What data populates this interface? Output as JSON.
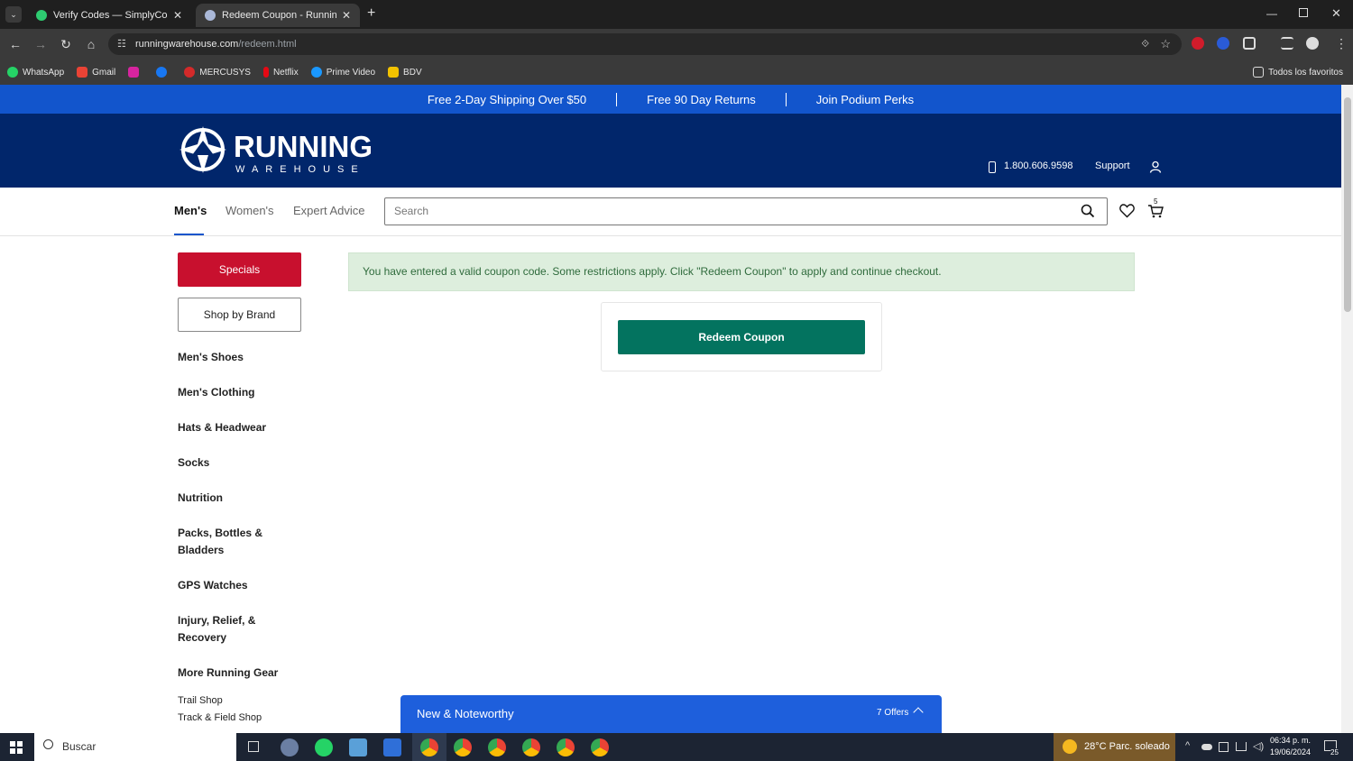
{
  "browser": {
    "tabs": [
      {
        "title": "Verify Codes — SimplyCodes",
        "active": false
      },
      {
        "title": "Redeem Coupon - Running Wa",
        "active": true
      }
    ],
    "new_tab": "+",
    "url_host": "runningwarehouse.com",
    "url_path": "/redeem.html",
    "bookmarks": [
      "WhatsApp",
      "Gmail",
      "",
      "",
      "MERCUSYS",
      "Netflix",
      "Prime Video",
      "BDV"
    ],
    "all_bookmarks": "Todos los favoritos"
  },
  "promo": {
    "items": [
      "Free 2-Day Shipping Over $50",
      "Free 90 Day Returns",
      "Join Podium Perks"
    ]
  },
  "header": {
    "brand": "RUNNING",
    "brand_sub": "WAREHOUSE",
    "phone": "1.800.606.9598",
    "support": "Support"
  },
  "nav": {
    "tabs": [
      "Men's",
      "Women's",
      "Expert Advice"
    ],
    "active_tab": "Men's",
    "search_placeholder": "Search",
    "cart_count": "5"
  },
  "sidebar": {
    "specials": "Specials",
    "shop_by_brand": "Shop by Brand",
    "categories": [
      "Men's Shoes",
      "Men's Clothing",
      "Hats & Headwear",
      "Socks",
      "Nutrition",
      "Packs, Bottles & Bladders",
      "GPS Watches",
      "Injury, Relief, & Recovery",
      "More Running Gear"
    ],
    "subitems": [
      "Trail Shop",
      "Track & Field Shop"
    ]
  },
  "main": {
    "alert": "You have entered a valid coupon code. Some restrictions apply. Click \"Redeem Coupon\" to apply and continue checkout.",
    "redeem_button": "Redeem Coupon"
  },
  "new_noteworthy": {
    "title": "New & Noteworthy",
    "offers": "7 Offers"
  },
  "taskbar": {
    "search": "Buscar",
    "weather": "28°C  Parc. soleado",
    "time": "06:34 p. m.",
    "date": "19/06/2024",
    "notifications": "25"
  },
  "colors": {
    "promo_bg": "#1255cc",
    "header_bg": "#01266b",
    "specials_bg": "#c8102e",
    "redeem_bg": "#03735f",
    "alert_bg": "#ddeedd",
    "noteworthy_bg": "#1e5fdc"
  }
}
